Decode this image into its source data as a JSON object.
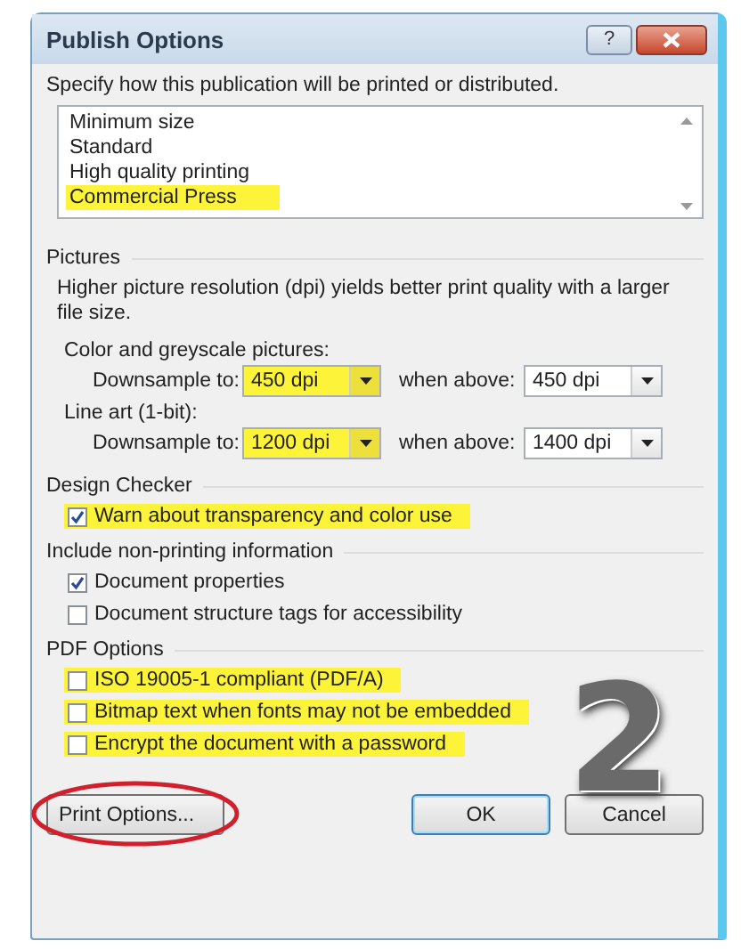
{
  "window": {
    "title": "Publish Options",
    "help_glyph": "?"
  },
  "intro": "Specify how this publication will be printed or distributed.",
  "presets": [
    {
      "label": "Minimum size",
      "highlighted": false
    },
    {
      "label": "Standard",
      "highlighted": false
    },
    {
      "label": "High quality printing",
      "highlighted": false
    },
    {
      "label": "Commercial Press",
      "highlighted": true
    }
  ],
  "pictures": {
    "heading": "Pictures",
    "description": "Higher picture resolution (dpi) yields better print quality with a larger file size.",
    "groups": [
      {
        "label": "Color and greyscale pictures:",
        "downsample_label": "Downsample to:",
        "downsample_value": "450 dpi",
        "highlighted": true,
        "above_label": "when above:",
        "above_value": "450 dpi"
      },
      {
        "label": "Line art (1-bit):",
        "downsample_label": "Downsample to:",
        "downsample_value": "1200 dpi",
        "highlighted": true,
        "above_label": "when above:",
        "above_value": "1400 dpi"
      }
    ]
  },
  "sections": [
    {
      "heading": "Design Checker",
      "options": [
        {
          "label": "Warn about transparency and color use",
          "checked": true,
          "highlighted": true
        }
      ]
    },
    {
      "heading": "Include non-printing information",
      "options": [
        {
          "label": "Document properties",
          "checked": true,
          "highlighted": false
        },
        {
          "label": "Document structure tags for accessibility",
          "checked": false,
          "highlighted": false
        }
      ]
    },
    {
      "heading": "PDF Options",
      "options": [
        {
          "label": "ISO 19005-1 compliant (PDF/A)",
          "checked": false,
          "highlighted": true
        },
        {
          "label": "Bitmap text when fonts may not be embedded",
          "checked": false,
          "highlighted": true
        },
        {
          "label": "Encrypt the document with a password",
          "checked": false,
          "highlighted": true
        }
      ]
    }
  ],
  "step_number": "2",
  "buttons": [
    {
      "label": "Print Options...",
      "kind": "secondary",
      "circled": true
    },
    {
      "label": "OK",
      "kind": "default",
      "circled": false
    },
    {
      "label": "Cancel",
      "kind": "cancel",
      "circled": false
    }
  ]
}
